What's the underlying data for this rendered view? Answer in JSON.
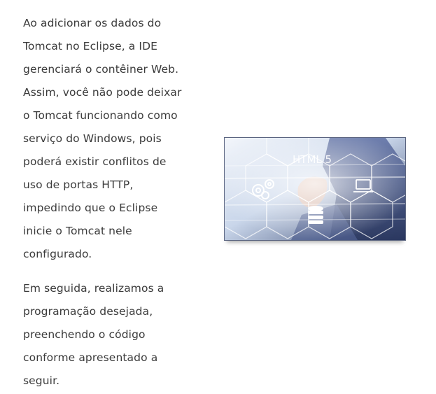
{
  "article": {
    "paragraphs": [
      {
        "lines": [
          "Ao adicionar os dados do",
          "Tomcat no Eclipse, a IDE",
          "gerenciará o contêiner Web.",
          "Assim, você não pode deixar",
          "o Tomcat funcionando como",
          "serviço do Windows, pois",
          "poderá existir conflitos de",
          "uso de portas HTTP,",
          "impedindo que o Eclipse",
          "inicie o Tomcat nele",
          "configurado."
        ]
      },
      {
        "lines": [
          "Em seguida, realizamos a",
          "programação desejada,",
          "preenchendo o código",
          "conforme apresentado a",
          "seguir."
        ]
      }
    ]
  },
  "figure": {
    "label": "HTML 5",
    "icons": [
      "gears-icon",
      "laptop-icon",
      "database-icon"
    ],
    "colors": {
      "background_light": "#e8eef6",
      "background_dark": "#3b4a74",
      "frame": "#5a6480"
    }
  }
}
